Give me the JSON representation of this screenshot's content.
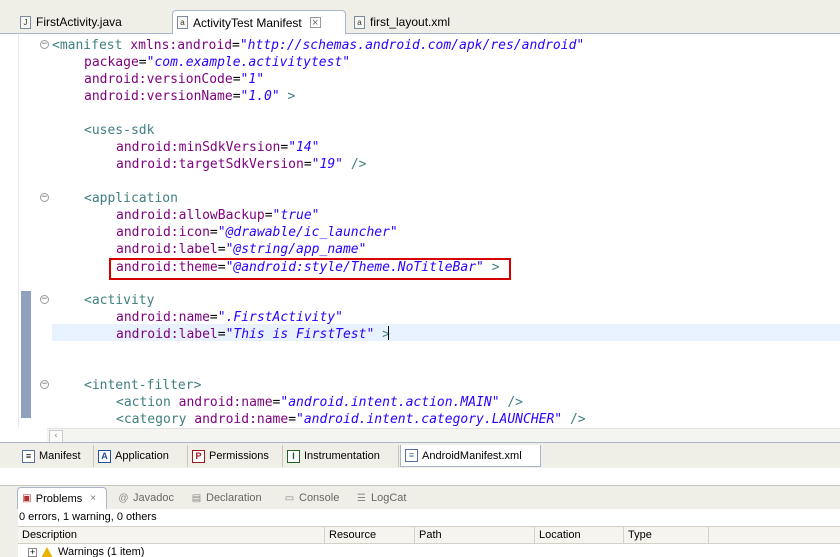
{
  "editor_tabs": [
    {
      "label": "FirstActivity.java",
      "icon": "java-file-icon"
    },
    {
      "label": "ActivityTest Manifest",
      "icon": "android-manifest-icon",
      "active": true
    },
    {
      "label": "first_layout.xml",
      "icon": "xml-file-icon"
    }
  ],
  "code": {
    "l1": {
      "tag": "<manifest",
      "attr": "xmlns:android",
      "val": "\"http://schemas.android.com/apk/res/android\""
    },
    "l2": {
      "attr": "package",
      "val": "\"com.example.activitytest\""
    },
    "l3": {
      "attr": "android:versionCode",
      "val": "\"1\""
    },
    "l4": {
      "attr": "android:versionName",
      "val": "\"1.0\"",
      "close": ">"
    },
    "l5": {
      "tag": "<uses-sdk"
    },
    "l6": {
      "attr": "android:minSdkVersion",
      "val": "\"14\""
    },
    "l7": {
      "attr": "android:targetSdkVersion",
      "val": "\"19\"",
      "close": "/>"
    },
    "l8": {
      "tag": "<application"
    },
    "l9": {
      "attr": "android:allowBackup",
      "val": "\"true\""
    },
    "l10": {
      "attr": "android:icon",
      "val": "\"@drawable/ic_launcher\""
    },
    "l11": {
      "attr": "android:label",
      "val": "\"@string/app_name\""
    },
    "l12": {
      "attr": "android:theme",
      "val": "\"@android:style/Theme.NoTitleBar\"",
      "close": ">"
    },
    "l13": {
      "tag": "<activity"
    },
    "l14": {
      "attr": "android:name",
      "val": "\".FirstActivity\""
    },
    "l15": {
      "attr": "android:label",
      "val": "\"This is FirstTest\"",
      "close": ">"
    },
    "l16": {
      "tag": "<intent-filter>"
    },
    "l17": {
      "tag": "<action",
      "attr": "android:name",
      "val": "\"android.intent.action.MAIN\"",
      "close": "/>"
    },
    "l18": {
      "tag": "<category",
      "attr": "android:name",
      "val": "\"android.intent.category.LAUNCHER\"",
      "close": "/>"
    }
  },
  "editor_bottom_tabs": [
    {
      "label": "Manifest",
      "icon": "manifest-overview-icon"
    },
    {
      "label": "Application",
      "icon": "A"
    },
    {
      "label": "Permissions",
      "icon": "P"
    },
    {
      "label": "Instrumentation",
      "icon": "I"
    },
    {
      "label": "AndroidManifest.xml",
      "icon": "xml-source-icon",
      "active": true
    }
  ],
  "views": [
    {
      "label": "Problems",
      "active": true
    },
    {
      "label": "Javadoc"
    },
    {
      "label": "Declaration"
    },
    {
      "label": "Console"
    },
    {
      "label": "LogCat"
    }
  ],
  "problems": {
    "summary": "0 errors, 1 warning, 0 others",
    "columns": [
      "Description",
      "Resource",
      "Path",
      "Location",
      "Type"
    ],
    "rows": [
      {
        "description": "Warnings (1 item)"
      }
    ]
  },
  "colors": {
    "highlight_box": "#d60000",
    "tag": "#3f7f7f",
    "attribute": "#7f007f",
    "value": "#2a00ff"
  }
}
